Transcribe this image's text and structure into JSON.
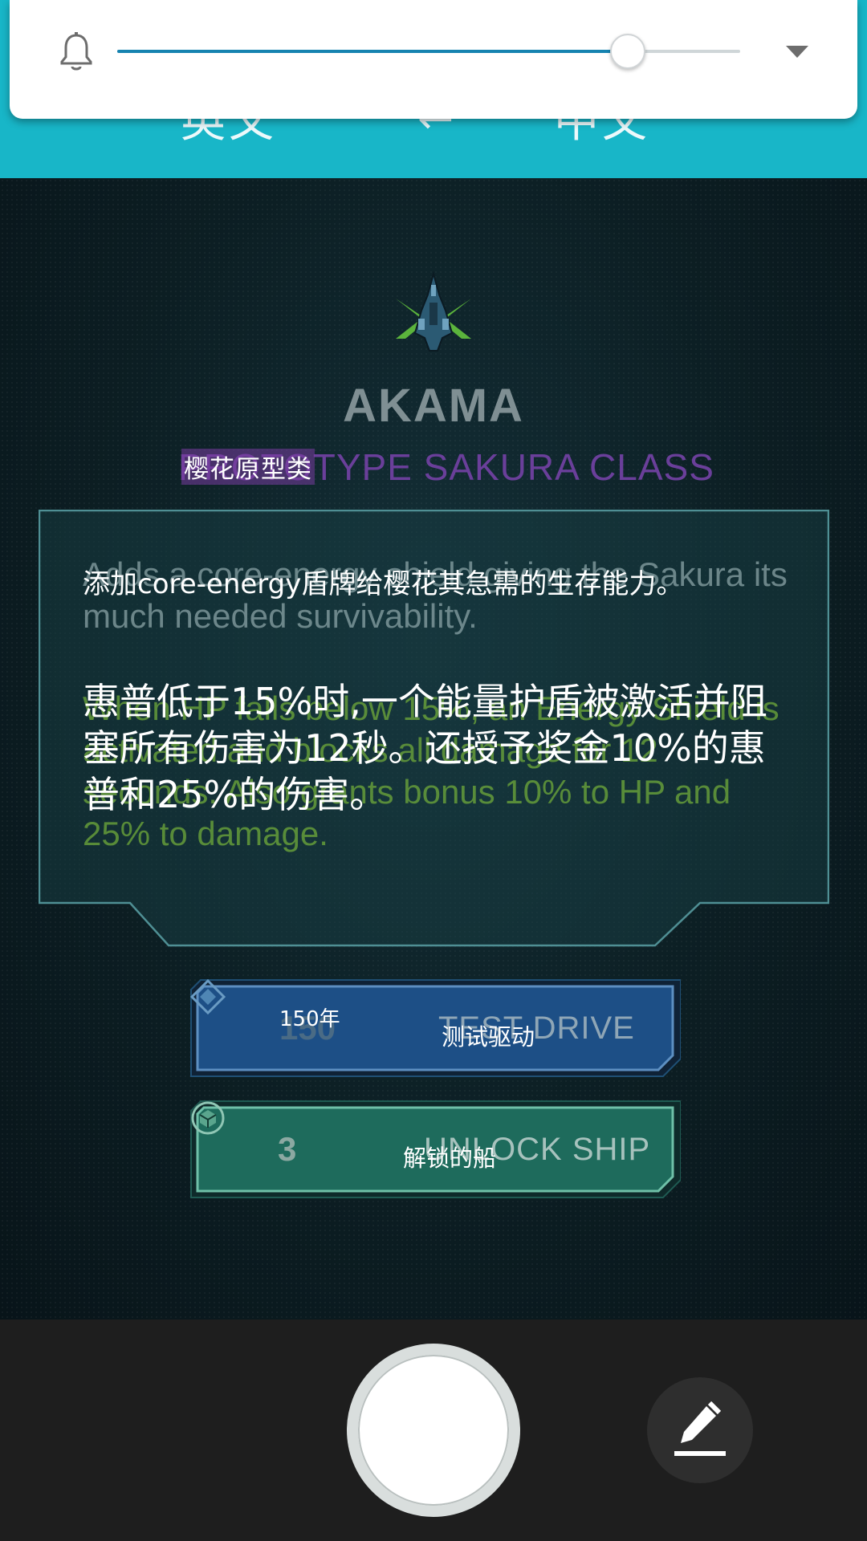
{
  "translate_bar": {
    "back_glyph": "‹",
    "source_language": "英文",
    "swap_glyph": "⇄",
    "target_language": "中文"
  },
  "volume_panel": {
    "level_fraction": 0.82,
    "icons": [
      "bell-icon",
      "expand-arrow-icon"
    ]
  },
  "game": {
    "ship_icon": "starship-icon",
    "ship_name": "AKAMA",
    "class_original": "PROTOTYPE SAKURA CLASS",
    "class_translated": "樱花原型类",
    "description_original": "Adds a core-energy shield giving the Sakura its much needed survivability.",
    "description_translated": "添加core-energy盾牌给樱花其急需的生存能力。",
    "effect_original": "When HP falls below 15%, an Energy Shield is activated and blocks all damage for 12 seconds. Also grants bonus 10% to HP and 25% to damage.",
    "effect_translated": "惠普低于15%时,一个能量护盾被激活并阻塞所有伤害为12秒。还授予奖金10%的惠普和25%的伤害。"
  },
  "buttons": {
    "test_drive": {
      "icon": "diamond-icon",
      "cost": "150",
      "cost_translated": "150年",
      "label": "TEST DRIVE",
      "label_translated": "测试驱动"
    },
    "unlock_ship": {
      "icon": "unlock-token-icon",
      "cost": "3",
      "label": "UNLOCK SHIP",
      "label_translated": "解锁的船"
    }
  },
  "bottom_bar": {
    "shutter": "shutter-button",
    "edit_icon": "pencil-icon"
  },
  "colors": {
    "translate_bar": "#18b6c8",
    "slider_fill": "#1683b0",
    "class_purple": "#6a3f9a",
    "effect_green": "#6aa33a",
    "test_drive_blue": "#1d4f86",
    "unlock_green": "#1e6b5c"
  }
}
